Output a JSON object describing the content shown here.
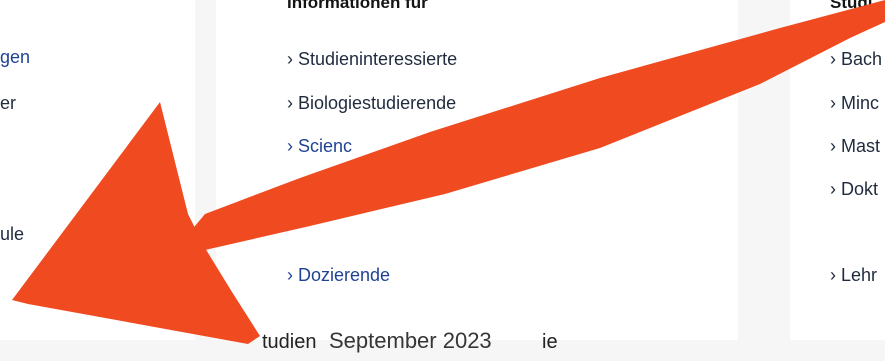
{
  "left_column": {
    "items": [
      "gen",
      "er",
      "ule"
    ]
  },
  "middle_column": {
    "heading": "Informationen für",
    "links": [
      "› Studieninteressierte",
      "› Biologiestudierende",
      "› Scienc",
      "› Dozierende"
    ]
  },
  "right_column": {
    "heading": "Studi",
    "links": [
      "› Bach",
      "› Minc",
      "› Mast",
      "› Dokt",
      "› Lehr"
    ]
  },
  "footer": {
    "text": "tudien",
    "overlay_text": "September 2023",
    "trailing_text": "ie"
  },
  "colors": {
    "arrow": "#f04a20",
    "link_blue": "#1f4394",
    "link_dark": "#1f2b3d"
  }
}
